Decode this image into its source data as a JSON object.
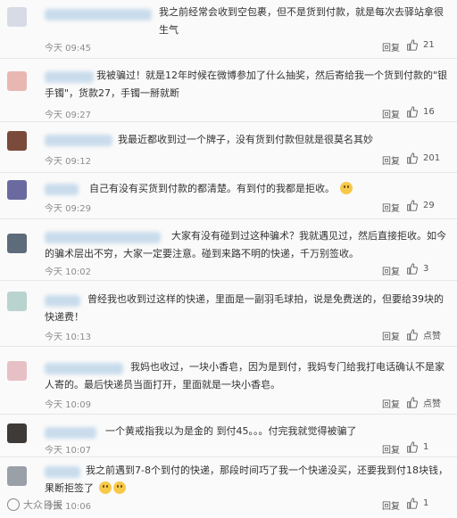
{
  "comments": [
    {
      "text": "我之前经常会收到空包裹，但不是货到付款，就是每次去驿站拿很生气",
      "time": "今天 09:45",
      "reply": "回复",
      "likes": "21",
      "avatar_color": "#d7dbe6"
    },
    {
      "text": "我被骗过！就是12年时候在微博参加了什么抽奖，然后寄给我一个货到付款的\"银手镯\"，货款27，手镯一掰就断",
      "time": "今天 09:27",
      "reply": "回复",
      "likes": "16",
      "avatar_color": "#e9b7b2"
    },
    {
      "text": "我最近都收到过一个牌子，没有货到付款但就是很莫名其妙",
      "time": "今天 09:12",
      "reply": "回复",
      "likes": "201",
      "avatar_color": "#7a4a3a"
    },
    {
      "text": "自己有没有买货到付款的都清楚。有到付的我都是拒收。",
      "time": "今天 09:29",
      "reply": "回复",
      "likes": "29",
      "avatar_color": "#6b6aa0",
      "emoji": "smile"
    },
    {
      "text": "大家有没有碰到过这种骗术？我就遇见过，然后直接拒收。如今的骗术层出不穷，大家一定要注意。碰到来路不明的快递，千万别签收。",
      "time": "今天 10:02",
      "reply": "回复",
      "likes": "3",
      "avatar_color": "#5d6b7a"
    },
    {
      "text": "曾经我也收到过这样的快递，里面是一副羽毛球拍，说是免费送的，但要给39块的快递费！",
      "time": "今天 10:13",
      "reply": "回复",
      "likes": "点赞",
      "avatar_color": "#b9d3cf"
    },
    {
      "text": "我妈也收过，一块小香皂，因为是到付，我妈专门给我打电话确认不是家人寄的。最后快递员当面打开，里面就是一块小香皂。",
      "time": "今天 10:09",
      "reply": "回复",
      "likes": "点赞",
      "avatar_color": "#e7c0c6"
    },
    {
      "text": "一个黄戒指我以为是金的 到付45。。。付完我就觉得被骗了",
      "time": "今天 10:07",
      "reply": "回复",
      "likes": "1",
      "avatar_color": "#3e3a38"
    },
    {
      "text": "我之前遇到7-8个到付的快递，那段时间巧了我一个快递没买，还要我到付18块钱，果断拒签了",
      "time": "今天 10:06",
      "reply": "回复",
      "likes": "1",
      "avatar_color": "#9aa0a8",
      "emoji": "laugh"
    }
  ],
  "watermark": "大众日报"
}
